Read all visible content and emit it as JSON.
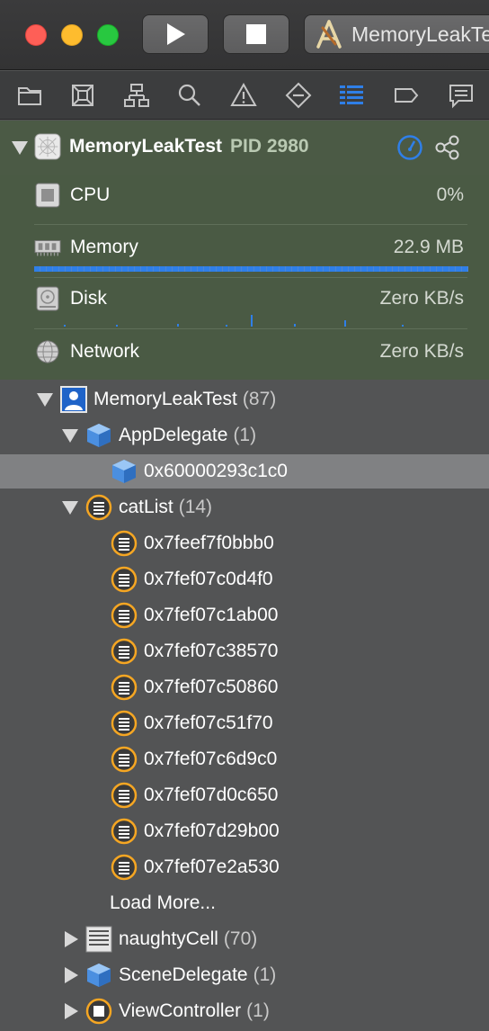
{
  "toolbar": {
    "scheme_label": "MemoryLeakTe"
  },
  "process": {
    "name": "MemoryLeakTest",
    "pid": "PID 2980"
  },
  "gauges": {
    "cpu": {
      "label": "CPU",
      "value": "0%"
    },
    "memory": {
      "label": "Memory",
      "value": "22.9 MB"
    },
    "disk": {
      "label": "Disk",
      "value": "Zero KB/s"
    },
    "network": {
      "label": "Network",
      "value": "Zero KB/s"
    }
  },
  "tree": {
    "root": {
      "label": "MemoryLeakTest",
      "count": "(87)"
    },
    "app_delegate": {
      "label": "AppDelegate",
      "count": "(1)",
      "instance": "0x60000293c1c0"
    },
    "cat_list": {
      "label": "catList",
      "count": "(14)",
      "instances": [
        "0x7feef7f0bbb0",
        "0x7fef07c0d4f0",
        "0x7fef07c1ab00",
        "0x7fef07c38570",
        "0x7fef07c50860",
        "0x7fef07c51f70",
        "0x7fef07c6d9c0",
        "0x7fef07d0c650",
        "0x7fef07d29b00",
        "0x7fef07e2a530"
      ],
      "load_more": "Load More..."
    },
    "naughty_cell": {
      "label": "naughtyCell",
      "count": "(70)"
    },
    "scene_delegate": {
      "label": "SceneDelegate",
      "count": "(1)"
    },
    "view_controller": {
      "label": "ViewController",
      "count": "(1)"
    }
  },
  "colors": {
    "accent": "#2f7fe8",
    "object_orange": "#f5a623",
    "class_blue": "#5fa8f5"
  }
}
